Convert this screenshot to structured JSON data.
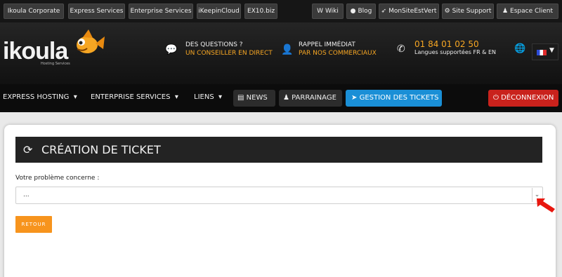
{
  "topbar": {
    "left_links": [
      "Ikoula Corporate",
      "Express Services",
      "Enterprise Services",
      "iKeepinCloud",
      "EX10.biz"
    ],
    "right_links": [
      {
        "icon": "wiki-icon",
        "label": "Wiki"
      },
      {
        "icon": "chat-bubble-icon",
        "label": "Blog"
      },
      {
        "icon": "rocket-icon",
        "label": "MonSiteEstVert"
      },
      {
        "icon": "support-icon",
        "label": "Site Support"
      },
      {
        "icon": "user-icon",
        "label": "Espace Client"
      }
    ]
  },
  "header": {
    "logo": "ikoula",
    "logo_sub": "Hosting Services",
    "questions": {
      "title": "DES QUESTIONS ?",
      "subtitle": "UN CONSEILLER EN DIRECT"
    },
    "callback": {
      "title": "RAPPEL IMMÉDIAT",
      "subtitle": "PAR NOS COMMERCIAUX"
    },
    "phone": {
      "number": "01 84 01 02 50",
      "subtitle": "Langues supportées FR & EN"
    },
    "language": "FR"
  },
  "nav": {
    "express_hosting": "EXPRESS HOSTING",
    "enterprise_services": "ENTERPRISE SERVICES",
    "liens": "LIENS",
    "news": "NEWS",
    "parrainage": "PARRAINAGE",
    "gestion_tickets": "GESTION DES TICKETS",
    "deconnexion": "DÉCONNEXION"
  },
  "main": {
    "title": "CRÉATION DE TICKET",
    "field_label": "Votre problème concerne :",
    "select_value": "...",
    "back_button": "RETOUR"
  },
  "colors": {
    "accent_orange": "#f6a623",
    "button_blue": "#1a8fd6",
    "button_red": "#c9221c",
    "back_orange": "#f7941d"
  }
}
